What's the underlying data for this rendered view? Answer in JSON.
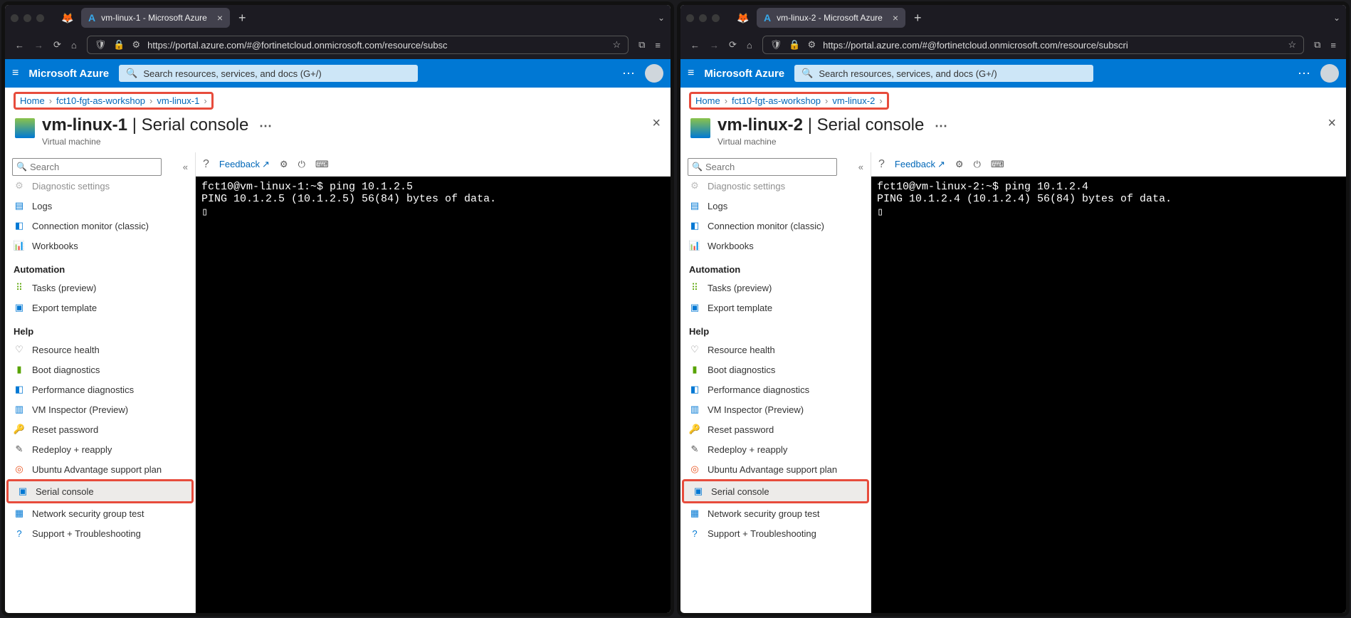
{
  "windows": [
    {
      "tab_title": "vm-linux-1 - Microsoft Azure",
      "url": "https://portal.azure.com/#@fortinetcloud.onmicrosoft.com/resource/subsc",
      "brand": "Microsoft Azure",
      "search_placeholder": "Search resources, services, and docs (G+/)",
      "breadcrumb": {
        "home": "Home",
        "rg": "fct10-fgt-as-workshop",
        "vm": "vm-linux-1"
      },
      "page": {
        "name": "vm-linux-1",
        "suffix": " | Serial console",
        "subtitle": "Virtual machine"
      },
      "sidebar": {
        "search_placeholder": "Search",
        "top": [
          {
            "label": "Diagnostic settings",
            "icon": "⚙",
            "color": "#888"
          },
          {
            "label": "Logs",
            "icon": "▤",
            "color": "#0078d4"
          },
          {
            "label": "Connection monitor (classic)",
            "icon": "◧",
            "color": "#0078d4"
          },
          {
            "label": "Workbooks",
            "icon": "📊",
            "color": "#0078d4"
          }
        ],
        "groups": [
          {
            "title": "Automation",
            "items": [
              {
                "label": "Tasks (preview)",
                "icon": "⠿",
                "color": "#57a300"
              },
              {
                "label": "Export template",
                "icon": "▣",
                "color": "#0078d4"
              }
            ]
          },
          {
            "title": "Help",
            "items": [
              {
                "label": "Resource health",
                "icon": "♡",
                "color": "#888"
              },
              {
                "label": "Boot diagnostics",
                "icon": "▮",
                "color": "#57a300"
              },
              {
                "label": "Performance diagnostics",
                "icon": "◧",
                "color": "#0078d4"
              },
              {
                "label": "VM Inspector (Preview)",
                "icon": "▥",
                "color": "#0078d4"
              },
              {
                "label": "Reset password",
                "icon": "🔑",
                "color": "#f2c811"
              },
              {
                "label": "Redeploy + reapply",
                "icon": "✎",
                "color": "#555"
              },
              {
                "label": "Ubuntu Advantage support plan",
                "icon": "◎",
                "color": "#e95420"
              },
              {
                "label": "Serial console",
                "icon": "▣",
                "color": "#0078d4",
                "active": true,
                "highlight": true
              },
              {
                "label": "Network security group test",
                "icon": "▦",
                "color": "#0078d4"
              },
              {
                "label": "Support + Troubleshooting",
                "icon": "?",
                "color": "#0078d4"
              }
            ]
          }
        ]
      },
      "console_tb": {
        "feedback": "Feedback"
      },
      "terminal": "fct10@vm-linux-1:~$ ping 10.1.2.5\nPING 10.1.2.5 (10.1.2.5) 56(84) bytes of data.\n▯"
    },
    {
      "tab_title": "vm-linux-2 - Microsoft Azure",
      "url": "https://portal.azure.com/#@fortinetcloud.onmicrosoft.com/resource/subscri",
      "brand": "Microsoft Azure",
      "search_placeholder": "Search resources, services, and docs (G+/)",
      "breadcrumb": {
        "home": "Home",
        "rg": "fct10-fgt-as-workshop",
        "vm": "vm-linux-2"
      },
      "page": {
        "name": "vm-linux-2",
        "suffix": " | Serial console",
        "subtitle": "Virtual machine"
      },
      "sidebar": {
        "search_placeholder": "Search",
        "top": [
          {
            "label": "Diagnostic settings",
            "icon": "⚙",
            "color": "#888"
          },
          {
            "label": "Logs",
            "icon": "▤",
            "color": "#0078d4"
          },
          {
            "label": "Connection monitor (classic)",
            "icon": "◧",
            "color": "#0078d4"
          },
          {
            "label": "Workbooks",
            "icon": "📊",
            "color": "#0078d4"
          }
        ],
        "groups": [
          {
            "title": "Automation",
            "items": [
              {
                "label": "Tasks (preview)",
                "icon": "⠿",
                "color": "#57a300"
              },
              {
                "label": "Export template",
                "icon": "▣",
                "color": "#0078d4"
              }
            ]
          },
          {
            "title": "Help",
            "items": [
              {
                "label": "Resource health",
                "icon": "♡",
                "color": "#888"
              },
              {
                "label": "Boot diagnostics",
                "icon": "▮",
                "color": "#57a300"
              },
              {
                "label": "Performance diagnostics",
                "icon": "◧",
                "color": "#0078d4"
              },
              {
                "label": "VM Inspector (Preview)",
                "icon": "▥",
                "color": "#0078d4"
              },
              {
                "label": "Reset password",
                "icon": "🔑",
                "color": "#f2c811"
              },
              {
                "label": "Redeploy + reapply",
                "icon": "✎",
                "color": "#555"
              },
              {
                "label": "Ubuntu Advantage support plan",
                "icon": "◎",
                "color": "#e95420"
              },
              {
                "label": "Serial console",
                "icon": "▣",
                "color": "#0078d4",
                "active": true,
                "highlight": true
              },
              {
                "label": "Network security group test",
                "icon": "▦",
                "color": "#0078d4"
              },
              {
                "label": "Support + Troubleshooting",
                "icon": "?",
                "color": "#0078d4"
              }
            ]
          }
        ]
      },
      "console_tb": {
        "feedback": "Feedback"
      },
      "terminal": "fct10@vm-linux-2:~$ ping 10.1.2.4\nPING 10.1.2.4 (10.1.2.4) 56(84) bytes of data.\n▯"
    }
  ]
}
